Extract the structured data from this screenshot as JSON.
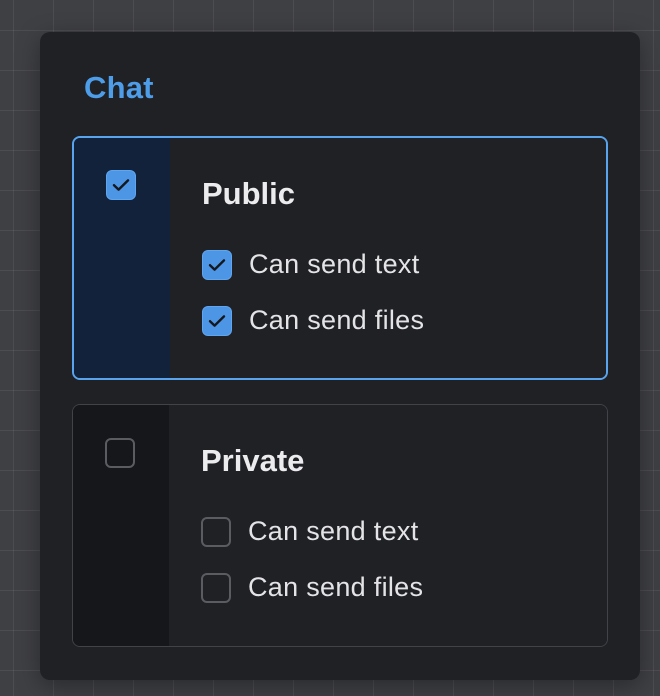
{
  "panel": {
    "title": "Chat"
  },
  "groups": [
    {
      "title": "Public",
      "checked": true,
      "options": [
        {
          "label": "Can send text",
          "checked": true
        },
        {
          "label": "Can send files",
          "checked": true
        }
      ]
    },
    {
      "title": "Private",
      "checked": false,
      "options": [
        {
          "label": "Can send text",
          "checked": false
        },
        {
          "label": "Can send files",
          "checked": false
        }
      ]
    }
  ],
  "colors": {
    "accent": "#4d9de8",
    "selected_border": "#58a4ee",
    "checkbox_fill": "#4d96e6",
    "panel_bg": "#202125"
  },
  "icons": {
    "checked": "checkmark-icon"
  }
}
